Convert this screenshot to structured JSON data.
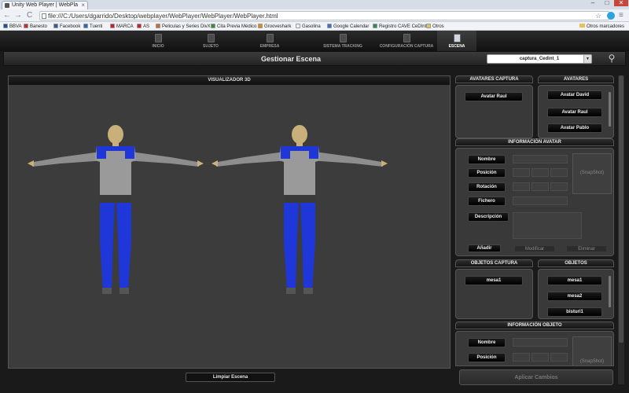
{
  "browser": {
    "tab_title": "Unity Web Player | WebPla",
    "tab_close": "×",
    "url": "file:///C:/Users/dgarrido/Desktop/webplayer/WebPlayer/WebPlayer/WebPlayer.html",
    "back": "←",
    "forward": "→",
    "reload": "C",
    "star": "☆",
    "menu": "≡",
    "minimize": "–",
    "maximize": "□",
    "close": "✕",
    "bookmarks": [
      {
        "label": "BBVA",
        "color": "#1b4fa0"
      },
      {
        "label": "Banesto",
        "color": "#c9302c"
      },
      {
        "label": "Facebook",
        "color": "#3b5998"
      },
      {
        "label": "Tuenti",
        "color": "#2a6ab3"
      },
      {
        "label": "MARCA",
        "color": "#d21f26"
      },
      {
        "label": "AS",
        "color": "#d21f26"
      },
      {
        "label": "Peliculas y Series DivX",
        "color": "#cc6b2c"
      },
      {
        "label": "Cita Previa Médico",
        "color": "#3a8f3a"
      },
      {
        "label": "Grooveshark",
        "color": "#e08a1e"
      },
      {
        "label": "Gasolina",
        "color": "#eeeeee"
      },
      {
        "label": "Google Calendar",
        "color": "#3d72c8"
      },
      {
        "label": "Registro CAVE CeDInt",
        "color": "#2e8b57"
      },
      {
        "label": "Otros",
        "color": "#e8c15a"
      }
    ],
    "other_bookmarks": "Otros marcadores"
  },
  "nav": {
    "items": [
      "INICIO",
      "SUJETO",
      "EMPRESA",
      "SISTEMA TRACKING",
      "CONFIGURACIÓN CAPTURA",
      "ESCENA"
    ],
    "active": "ESCENA"
  },
  "header": {
    "title": "Gestionar Escena",
    "capture_select": "captura_Cedint_1",
    "select_arrow": "▼",
    "search_icon": "⚲"
  },
  "viewer": {
    "title": "VISUALIZADOR 3D",
    "clear_button": "Limpiar Escena"
  },
  "avatars_capture": {
    "title": "AVATARES CAPTURA",
    "items": [
      "Avatar Raul"
    ]
  },
  "avatars": {
    "title": "AVATARES",
    "items": [
      "Avatar David",
      "Avatar Raul",
      "Avatar Pablo"
    ]
  },
  "avatar_info": {
    "title": "INFORMACIÓN AVATAR",
    "buttons": [
      "Nombre",
      "Posición",
      "Rotación",
      "Fichero",
      "Descripción"
    ],
    "snapshot": "(SnapShot)",
    "add": "Añadir",
    "modify": "Modificar",
    "delete": "Eliminar"
  },
  "objects_capture": {
    "title": "OBJETOS CAPTURA",
    "items": [
      "mesa1"
    ]
  },
  "objects": {
    "title": "OBJETOS",
    "items": [
      "mesa1",
      "mesa2",
      "bisturi1"
    ]
  },
  "object_info": {
    "title": "INFORMACIÓN OBJETO",
    "buttons": [
      "Nombre",
      "Posición"
    ],
    "snapshot": "(SnapShot)"
  },
  "apply_button": "Aplicar Cambios",
  "colors": {
    "suit_blue": "#1f36d8",
    "shirt_gray": "#9a9a9a",
    "skin": "#c9b07a",
    "panel_bg": "#393939"
  }
}
